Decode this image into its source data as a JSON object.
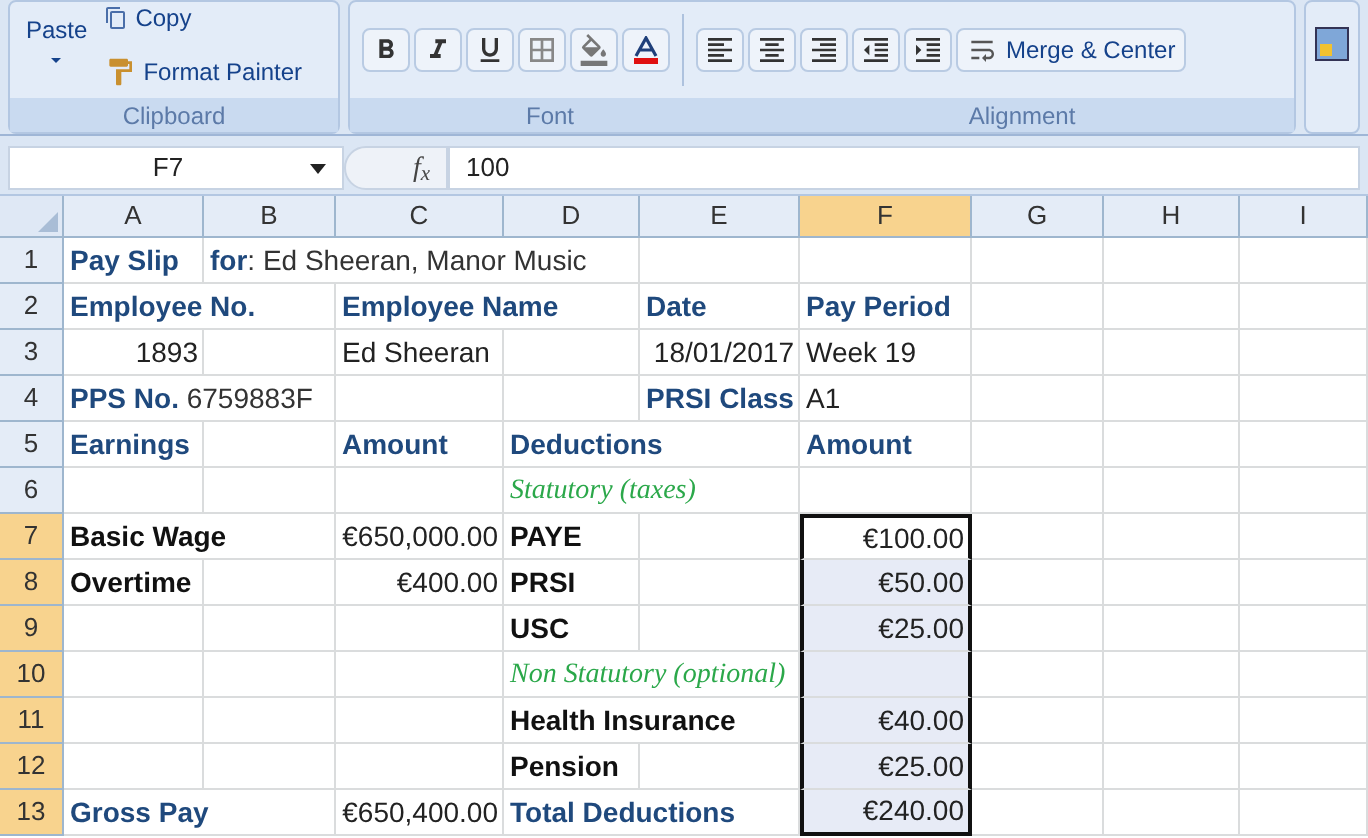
{
  "ribbon": {
    "clipboard": {
      "label": "Clipboard",
      "paste": "Paste",
      "copy": "Copy",
      "format_painter": "Format Painter"
    },
    "font": {
      "label": "Font"
    },
    "alignment": {
      "label": "Alignment",
      "merge": "Merge & Center"
    }
  },
  "formula_bar": {
    "name_box": "F7",
    "fx": "f$_{x}$",
    "value": "100"
  },
  "columns": [
    "A",
    "B",
    "C",
    "D",
    "E",
    "F",
    "G",
    "H",
    "I"
  ],
  "rows": [
    {
      "number": "1",
      "cells": [
        {
          "text": "Pay Slip",
          "kind": "label",
          "selected": false
        },
        {
          "text": "**for**: Ed Sheeran, Manor Music",
          "kind": "mixed",
          "selected": false
        },
        {
          "selected": false
        },
        {
          "selected": false
        },
        {
          "selected": false
        },
        {
          "selected": false
        },
        {
          "selected": false
        },
        {
          "selected": false
        },
        {
          "selected": false
        }
      ]
    },
    {
      "number": "2",
      "cells": [
        {
          "text": "Employee No.",
          "kind": "label",
          "selected": false
        },
        {
          "selected": false
        },
        {
          "text": "Employee Name",
          "kind": "label",
          "selected": false
        },
        {
          "selected": false
        },
        {
          "text": "Date",
          "kind": "label",
          "selected": false
        },
        {
          "text": "Pay Period",
          "kind": "label",
          "selected": false
        },
        {
          "selected": false
        },
        {
          "selected": false
        },
        {
          "selected": false
        }
      ]
    },
    {
      "number": "3",
      "cells": [
        {
          "text": "1893",
          "kind": "number",
          "selected": false
        },
        {
          "selected": false
        },
        {
          "text": "Ed Sheeran",
          "kind": "plain",
          "selected": false
        },
        {
          "selected": false
        },
        {
          "text": "18/01/2017",
          "kind": "number",
          "selected": false
        },
        {
          "text": "Week 19",
          "kind": "plain",
          "selected": false
        },
        {
          "selected": false
        },
        {
          "selected": false
        },
        {
          "selected": false
        }
      ]
    },
    {
      "number": "4",
      "cells": [
        {
          "text": "**PPS No.** 6759883F",
          "kind": "mixed",
          "selected": false
        },
        {
          "selected": false
        },
        {
          "selected": false
        },
        {
          "selected": false
        },
        {
          "text": "PRSI Class",
          "kind": "label",
          "selected": false
        },
        {
          "text": "A1",
          "kind": "plain",
          "selected": false
        },
        {
          "selected": false
        },
        {
          "selected": false
        },
        {
          "selected": false
        }
      ]
    },
    {
      "number": "5",
      "cells": [
        {
          "text": "Earnings",
          "kind": "label",
          "selected": false
        },
        {
          "selected": false
        },
        {
          "text": "Amount",
          "kind": "label",
          "selected": false
        },
        {
          "text": "Deductions",
          "kind": "label",
          "selected": false
        },
        {
          "selected": false
        },
        {
          "text": "Amount",
          "kind": "label",
          "selected": false
        },
        {
          "selected": false
        },
        {
          "selected": false
        },
        {
          "selected": false
        }
      ]
    },
    {
      "number": "6",
      "cells": [
        {
          "selected": false
        },
        {
          "selected": false
        },
        {
          "selected": false
        },
        {
          "text": "Statutory (taxes)",
          "kind": "note",
          "selected": false
        },
        {
          "selected": false
        },
        {
          "selected": false
        },
        {
          "selected": false
        },
        {
          "selected": false
        },
        {
          "selected": false
        }
      ]
    },
    {
      "number": "7",
      "cells": [
        {
          "text": "Basic Wage",
          "kind": "bold",
          "selected": false
        },
        {
          "selected": false
        },
        {
          "text": "€650,000.00",
          "kind": "number",
          "selected": false
        },
        {
          "text": "PAYE",
          "kind": "bold",
          "selected": false
        },
        {
          "selected": false
        },
        {
          "text": "€100.00",
          "kind": "number",
          "selected": true
        },
        {
          "selected": false
        },
        {
          "selected": false
        },
        {
          "selected": false
        }
      ]
    },
    {
      "number": "8",
      "cells": [
        {
          "text": "Overtime",
          "kind": "bold",
          "selected": false
        },
        {
          "selected": false
        },
        {
          "text": "€400.00",
          "kind": "number",
          "selected": false
        },
        {
          "text": "PRSI",
          "kind": "bold",
          "selected": false
        },
        {
          "selected": false
        },
        {
          "text": "€50.00",
          "kind": "number",
          "selected": true
        },
        {
          "selected": false
        },
        {
          "selected": false
        },
        {
          "selected": false
        }
      ]
    },
    {
      "number": "9",
      "cells": [
        {
          "selected": false
        },
        {
          "selected": false
        },
        {
          "selected": false
        },
        {
          "text": "USC",
          "kind": "bold",
          "selected": false
        },
        {
          "selected": false
        },
        {
          "text": "€25.00",
          "kind": "number",
          "selected": true
        },
        {
          "selected": false
        },
        {
          "selected": false
        },
        {
          "selected": false
        }
      ]
    },
    {
      "number": "10",
      "cells": [
        {
          "selected": false
        },
        {
          "selected": false
        },
        {
          "selected": false
        },
        {
          "text": "Non Statutory (optional)",
          "kind": "note",
          "selected": false
        },
        {
          "selected": false
        },
        {
          "selected": true
        },
        {
          "selected": false
        },
        {
          "selected": false
        },
        {
          "selected": false
        }
      ]
    },
    {
      "number": "11",
      "cells": [
        {
          "selected": false
        },
        {
          "selected": false
        },
        {
          "selected": false
        },
        {
          "text": "Health Insurance",
          "kind": "bold",
          "selected": false
        },
        {
          "selected": false
        },
        {
          "text": "€40.00",
          "kind": "number",
          "selected": true
        },
        {
          "selected": false
        },
        {
          "selected": false
        },
        {
          "selected": false
        }
      ]
    },
    {
      "number": "12",
      "cells": [
        {
          "selected": false
        },
        {
          "selected": false
        },
        {
          "selected": false
        },
        {
          "text": "Pension",
          "kind": "bold",
          "selected": false
        },
        {
          "selected": false
        },
        {
          "text": "€25.00",
          "kind": "number",
          "selected": true
        },
        {
          "selected": false
        },
        {
          "selected": false
        },
        {
          "selected": false
        }
      ]
    },
    {
      "number": "13",
      "cells": [
        {
          "text": "Gross Pay",
          "kind": "label",
          "selected": false
        },
        {
          "selected": false
        },
        {
          "text": "€650,400.00",
          "kind": "number",
          "selected": false
        },
        {
          "text": "Total Deductions",
          "kind": "label",
          "selected": false
        },
        {
          "selected": false
        },
        {
          "text": "€240.00",
          "kind": "number",
          "selected": true
        },
        {
          "selected": false
        },
        {
          "selected": false
        },
        {
          "selected": false
        }
      ]
    }
  ]
}
